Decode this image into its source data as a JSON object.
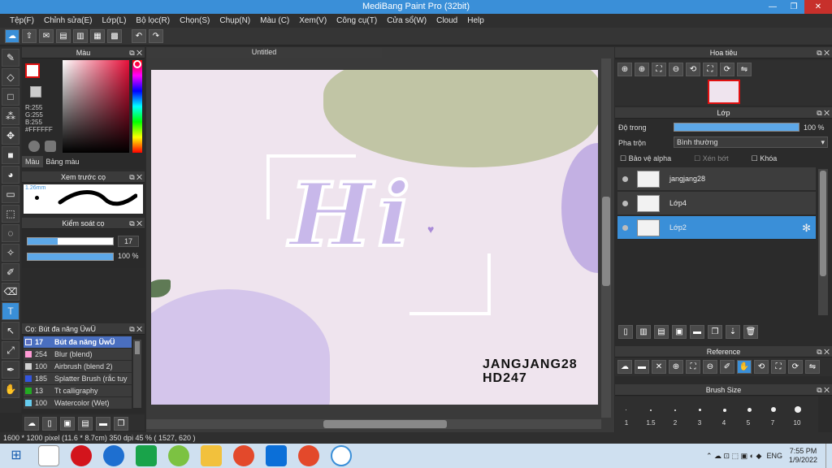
{
  "title": "MediBang Paint Pro (32bit)",
  "menu": [
    "Tệp(F)",
    "Chỉnh sửa(E)",
    "Lớp(L)",
    "Bộ lọc(R)",
    "Chọn(S)",
    "Chụp(N)",
    "Màu (C)",
    "Xem(V)",
    "Công cụ(T)",
    "Cửa sổ(W)",
    "Cloud",
    "Help"
  ],
  "color_panel": {
    "title": "Màu",
    "r": "R:255",
    "g": "G:255",
    "b": "B:255",
    "hex": "#FFFFFF",
    "tab1": "Màu",
    "tab2": "Bảng màu"
  },
  "brush_preview": {
    "title": "Xem trước cọ",
    "size": "1.26mm"
  },
  "brush_control": {
    "title": "Kiểm soát cọ",
    "size": "17",
    "opacity": "100 %"
  },
  "brush_list": {
    "title": "Cọ: Bút đa năng ÜwÜ",
    "items": [
      {
        "num": "17",
        "name": "Bút đa năng ÜwÜ",
        "color": "#5b6fbf"
      },
      {
        "num": "254",
        "name": "Blur (blend)",
        "color": "#ff9ad5"
      },
      {
        "num": "100",
        "name": "Airbrush (blend 2)",
        "color": "#d0d0d0"
      },
      {
        "num": "185",
        "name": "Splatter Brush (rắc tuy",
        "color": "#3355dd"
      },
      {
        "num": "13",
        "name": "Tt calligraphy",
        "color": "#22aa22"
      },
      {
        "num": "100",
        "name": "Watercolor (Wet)",
        "color": "#66ccee"
      }
    ]
  },
  "canvas_tab": "Untitled",
  "canvas_text": {
    "hi": "Hi",
    "line1": "JANGJANG28",
    "line2": "HD247"
  },
  "navigator": {
    "title": "Hoa tiêu"
  },
  "layer_panel": {
    "title": "Lớp",
    "opacity_label": "Độ trong",
    "opacity": "100 %",
    "blend_label": "Pha trộn",
    "blend": "Bình thường",
    "protect": "Bảo vệ alpha",
    "clip": "Xén bớt",
    "lock": "Khóa",
    "layers": [
      "jangjang28",
      "Lớp4",
      "Lớp2"
    ]
  },
  "reference": {
    "title": "Reference"
  },
  "brush_size": {
    "title": "Brush Size",
    "sizes": [
      "1",
      "1.5",
      "2",
      "3",
      "4",
      "5",
      "7",
      "10"
    ]
  },
  "status": "1600 * 1200 pixel   (11.6 * 8.7cm)   350 dpi   45 %   ( 1527, 620 )",
  "taskbar": {
    "lang": "ENG",
    "time": "7:55 PM",
    "date": "1/9/2022"
  },
  "colors": {
    "accent": "#3a8fd8",
    "title": "#3a8fd8",
    "close": "#c7302b"
  }
}
